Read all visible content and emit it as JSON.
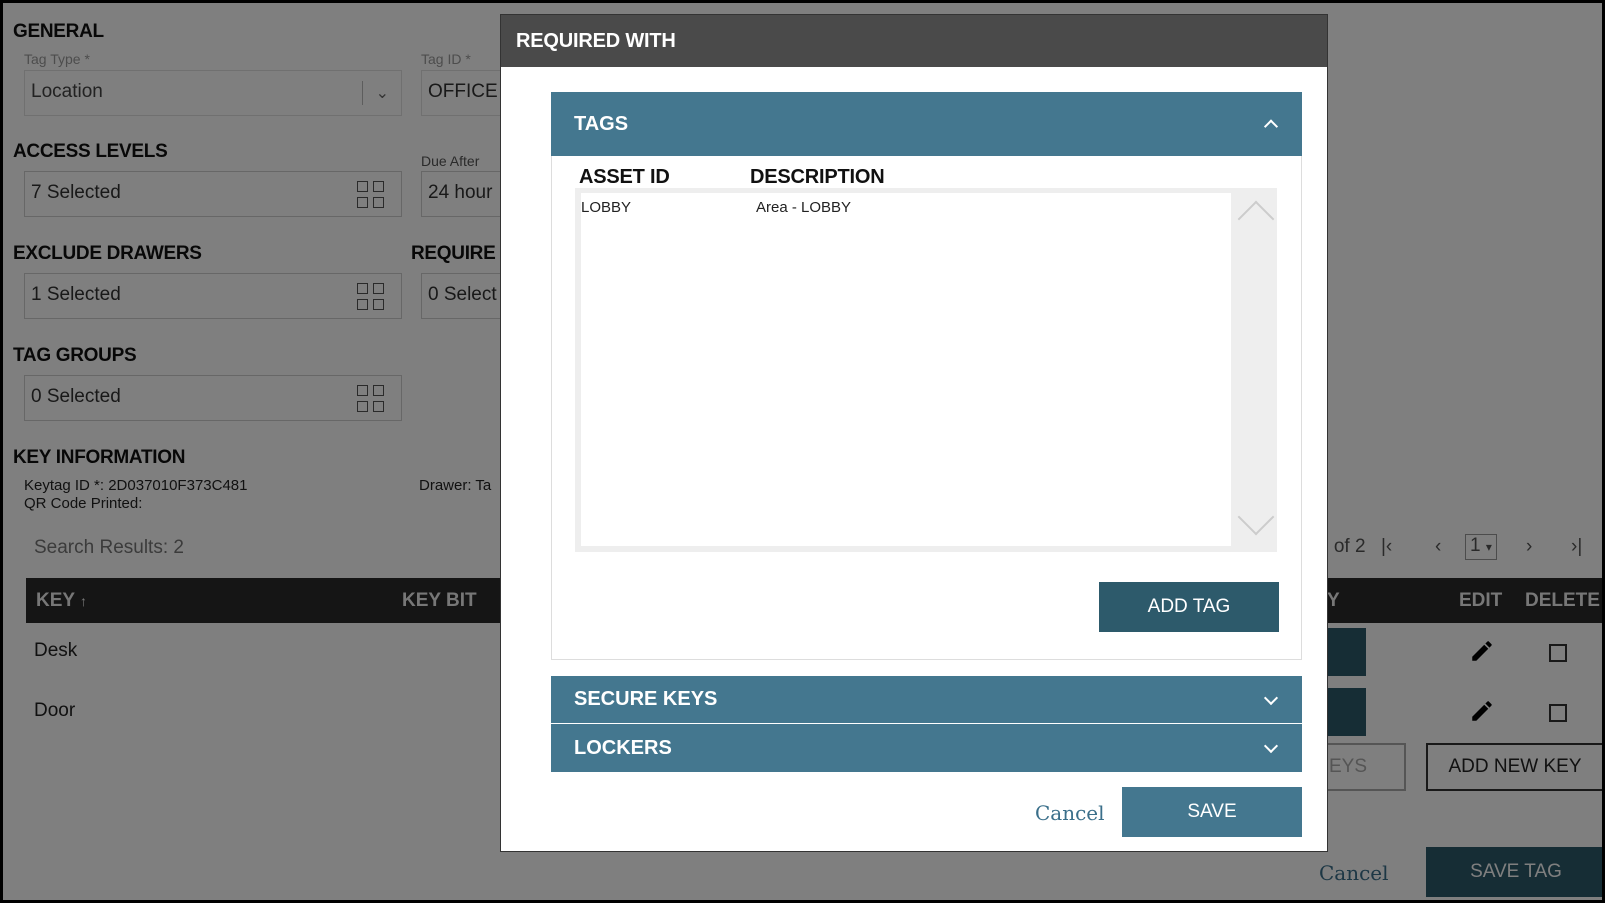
{
  "background": {
    "general": {
      "title": "GENERAL",
      "tag_type_label": "Tag Type *",
      "tag_type_value": "Location",
      "tag_id_label": "Tag ID *",
      "tag_id_value": "OFFICE"
    },
    "access_levels": {
      "title": "ACCESS LEVELS",
      "value": "7 Selected",
      "due_after_label": "Due After",
      "due_after_value": "24 hour"
    },
    "exclude_drawers": {
      "title": "EXCLUDE DRAWERS",
      "value": "1 Selected",
      "required_title": "REQUIRE",
      "required_value": "0 Select"
    },
    "tag_groups": {
      "title": "TAG GROUPS",
      "value": "0 Selected"
    },
    "key_information": {
      "title": "KEY INFORMATION",
      "keytag_id": "Keytag ID *: 2D037010F373C481",
      "qr_code": "QR Code Printed:",
      "drawer": "Drawer: Ta"
    },
    "search_results": "Search Results: 2",
    "pagination": {
      "page_of": "2 of 2",
      "current_page": "1"
    },
    "table": {
      "headers": {
        "key": "KEY",
        "key_bit": "KEY BIT",
        "partial": "Y",
        "edit": "EDIT",
        "delete": "DELETE"
      },
      "rows": [
        {
          "key": "Desk"
        },
        {
          "key": "Door"
        }
      ]
    },
    "buttons": {
      "keys_partial": "EYS",
      "add_new_key": "ADD NEW KEY",
      "cancel": "Cancel",
      "save_tag": "SAVE TAG"
    }
  },
  "modal": {
    "title": "REQUIRED WITH",
    "tags_panel": {
      "title": "TAGS",
      "columns": [
        "ASSET ID",
        "DESCRIPTION"
      ],
      "rows": [
        {
          "asset_id": "LOBBY",
          "description": "Area - LOBBY"
        }
      ],
      "add_tag_label": "ADD TAG"
    },
    "secure_keys_panel": {
      "title": "SECURE KEYS"
    },
    "lockers_panel": {
      "title": "LOCKERS"
    },
    "cancel_label": "Cancel",
    "save_label": "SAVE"
  },
  "colors": {
    "panel_header": "#44778f",
    "button_teal": "#2d5a6b",
    "modal_header": "#4a4a4a",
    "link": "#3a6f8a"
  }
}
